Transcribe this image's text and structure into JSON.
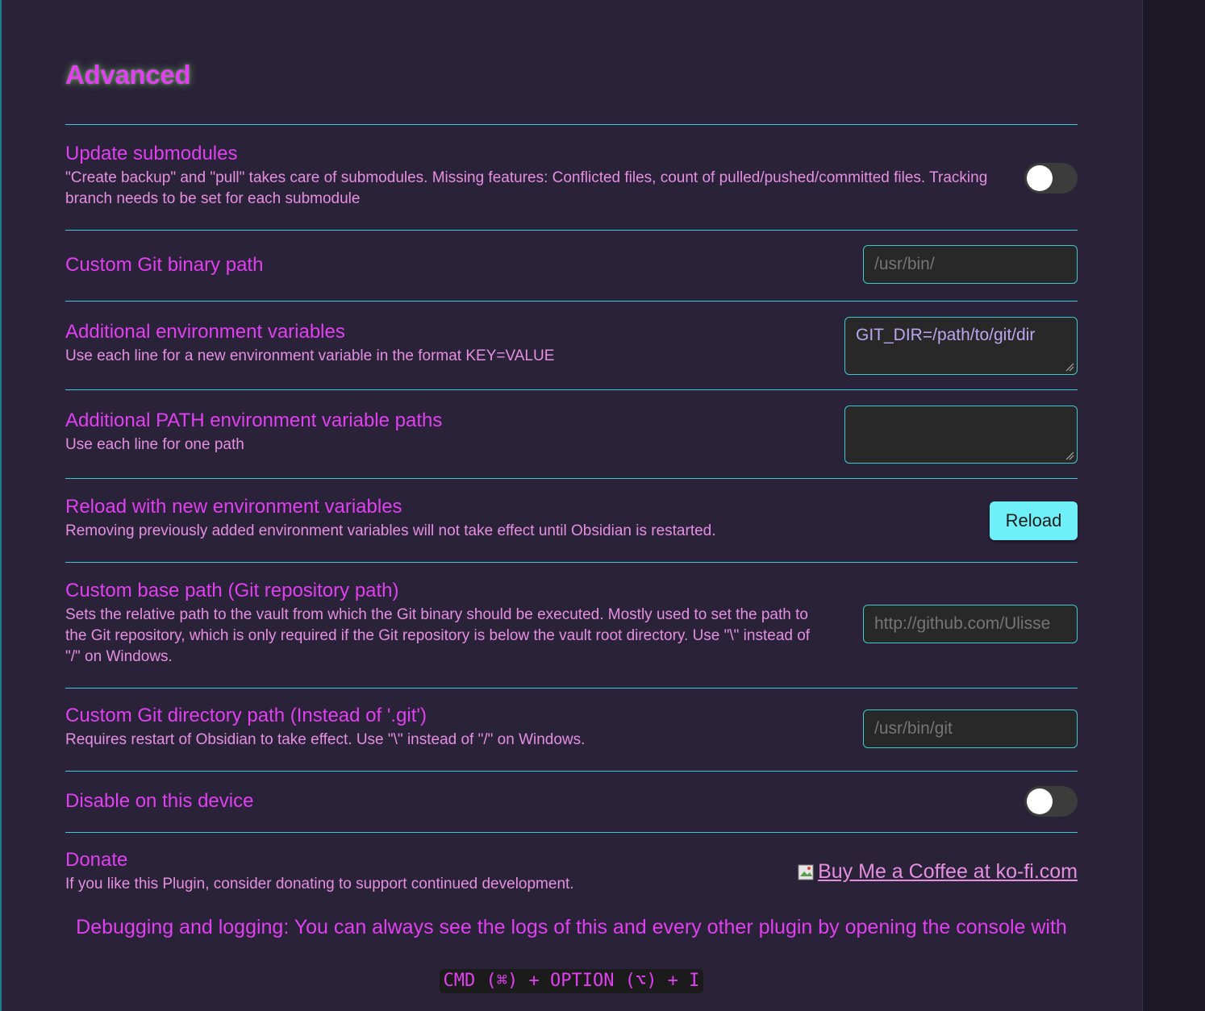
{
  "section": {
    "title": "Advanced"
  },
  "settings": {
    "update_submodules": {
      "name": "Update submodules",
      "desc": "\"Create backup\" and \"pull\" takes care of submodules. Missing features: Conflicted files, count of pulled/pushed/committed files. Tracking branch needs to be set for each submodule",
      "enabled": false
    },
    "git_binary_path": {
      "name": "Custom Git binary path",
      "placeholder": "/usr/bin/"
    },
    "env_vars": {
      "name": "Additional environment variables",
      "desc": "Use each line for a new environment variable in the format KEY=VALUE",
      "placeholder": "GIT_DIR=/path/to/git/dir"
    },
    "path_vars": {
      "name": "Additional PATH environment variable paths",
      "desc": "Use each line for one path",
      "value": ""
    },
    "reload_env": {
      "name": "Reload with new environment variables",
      "desc": "Removing previously added environment variables will not take effect until Obsidian is restarted.",
      "button_label": "Reload"
    },
    "base_path": {
      "name": "Custom base path (Git repository path)",
      "desc": "Sets the relative path to the vault from which the Git binary should be executed. Mostly used to set the path to the Git repository, which is only required if the Git repository is below the vault root directory. Use \"\\\" instead of \"/\" on Windows.",
      "placeholder": "http://github.com/Ulisse"
    },
    "git_dir_path": {
      "name": "Custom Git directory path (Instead of '.git')",
      "desc": "Requires restart of Obsidian to take effect. Use \"\\\" instead of \"/\" on Windows.",
      "placeholder": "/usr/bin/git"
    },
    "disable_device": {
      "name": "Disable on this device",
      "enabled": false
    },
    "donate": {
      "name": "Donate",
      "desc": "If you like this Plugin, consider donating to support continued development.",
      "link_text": "Buy Me a Coffee at ko-fi.com"
    }
  },
  "footer": {
    "debug_text": "Debugging and logging: You can always see the logs of this and every other plugin by opening the console with",
    "shortcut": "CMD (⌘) + OPTION (⌥) + I"
  },
  "colors": {
    "background": "#2a2238",
    "accent_text": "#e040f0",
    "desc_text": "#e58fe0",
    "divider": "#3fc8d0",
    "button": "#6ff0f8"
  }
}
